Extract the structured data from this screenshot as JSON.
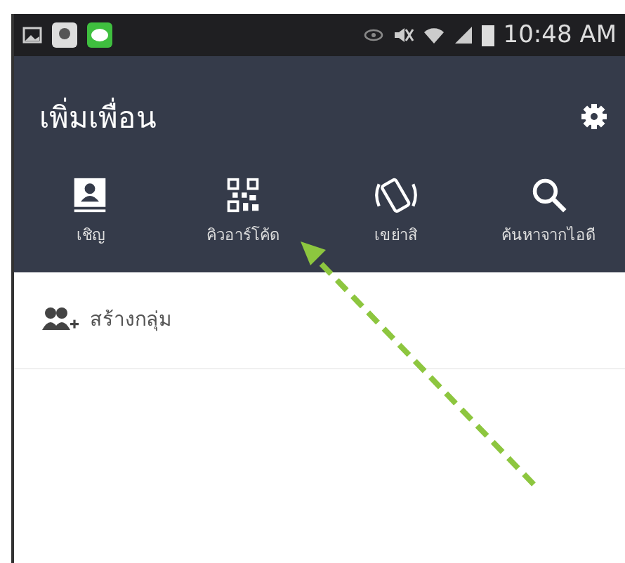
{
  "status_bar": {
    "time": "10:48 AM"
  },
  "header": {
    "title": "เพิ่มเพื่อน"
  },
  "actions": [
    {
      "kind": "contact",
      "label": "เชิญ"
    },
    {
      "kind": "qr",
      "label": "คิวอาร์โค้ด"
    },
    {
      "kind": "shake",
      "label": "เขย่าสิ"
    },
    {
      "kind": "search",
      "label": "ค้นหาจากไอดี"
    }
  ],
  "list": [
    {
      "label": "สร้างกลุ่ม"
    }
  ]
}
